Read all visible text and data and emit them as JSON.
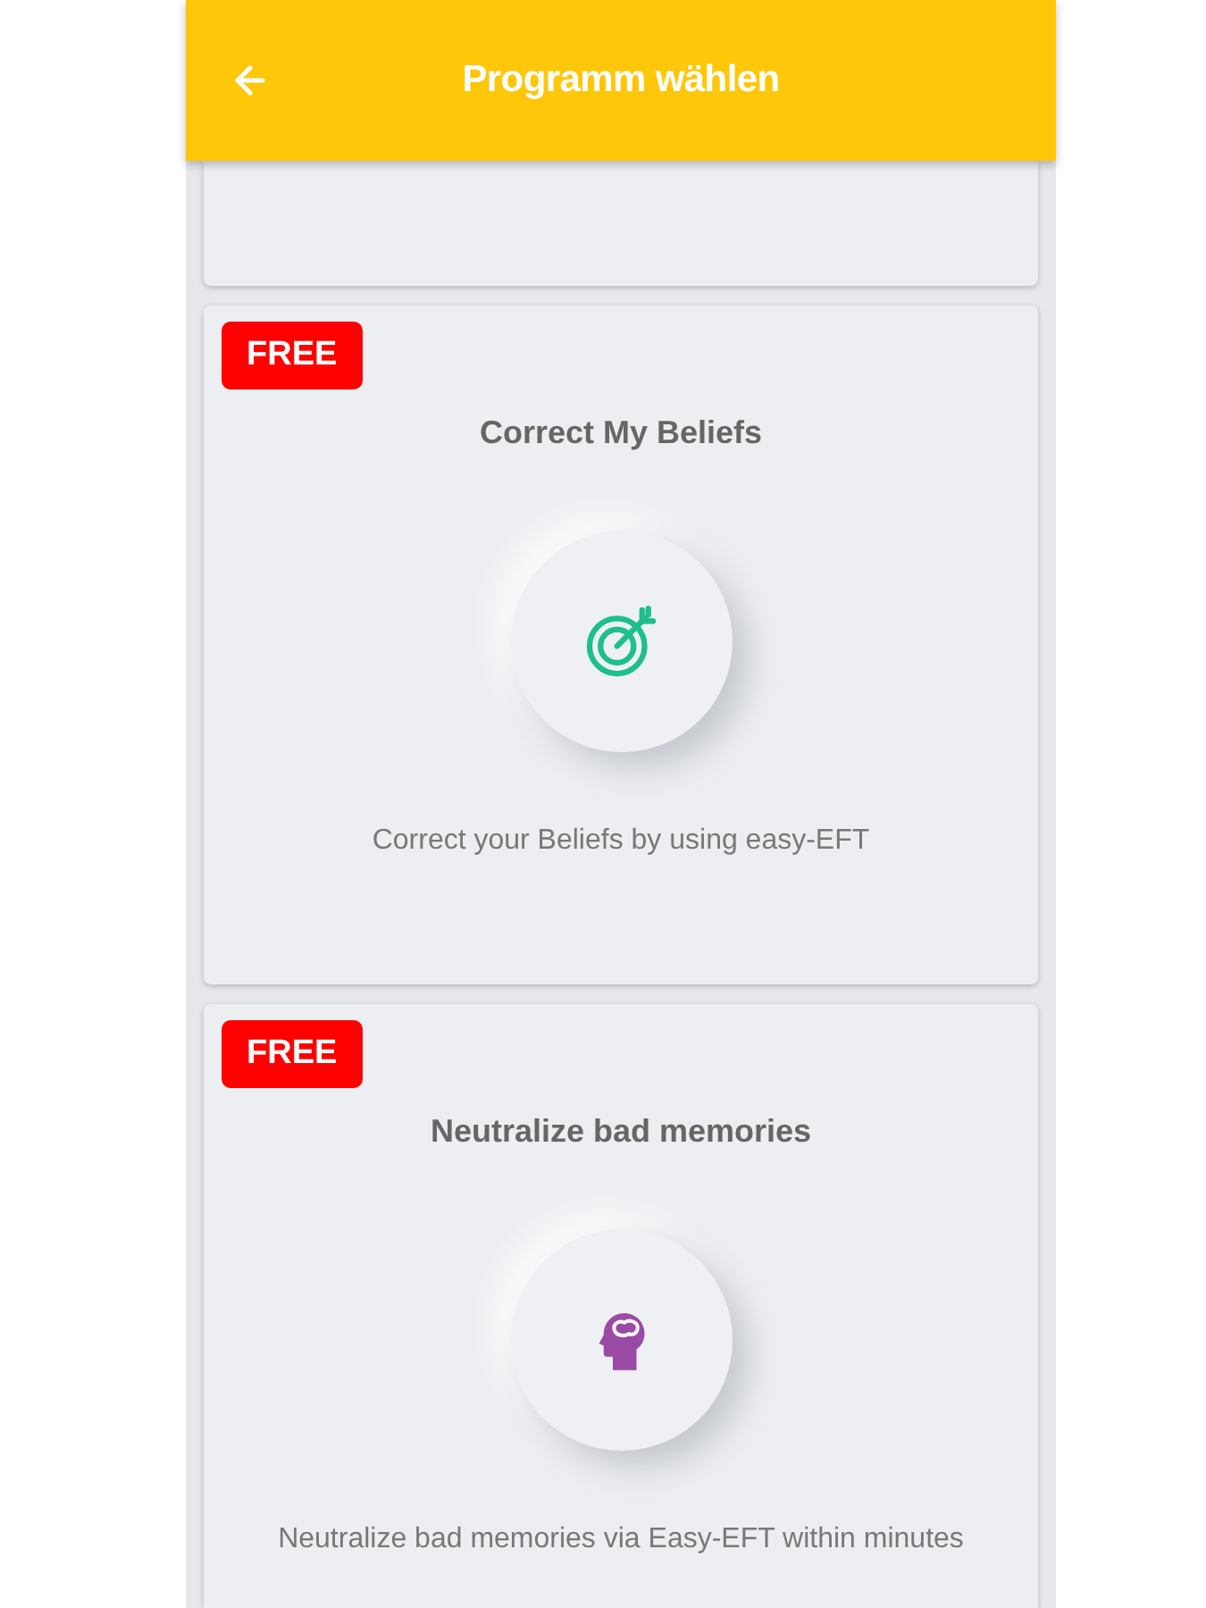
{
  "header": {
    "title": "Programm wählen"
  },
  "programs": [
    {
      "kind": "target",
      "badge": "FREE",
      "title": "Correct My Beliefs",
      "description": "Correct your Beliefs by using easy-EFT"
    },
    {
      "kind": "head",
      "badge": "FREE",
      "title": "Neutralize bad memories",
      "description": "Neutralize bad memories via Easy-EFT within minutes"
    }
  ]
}
